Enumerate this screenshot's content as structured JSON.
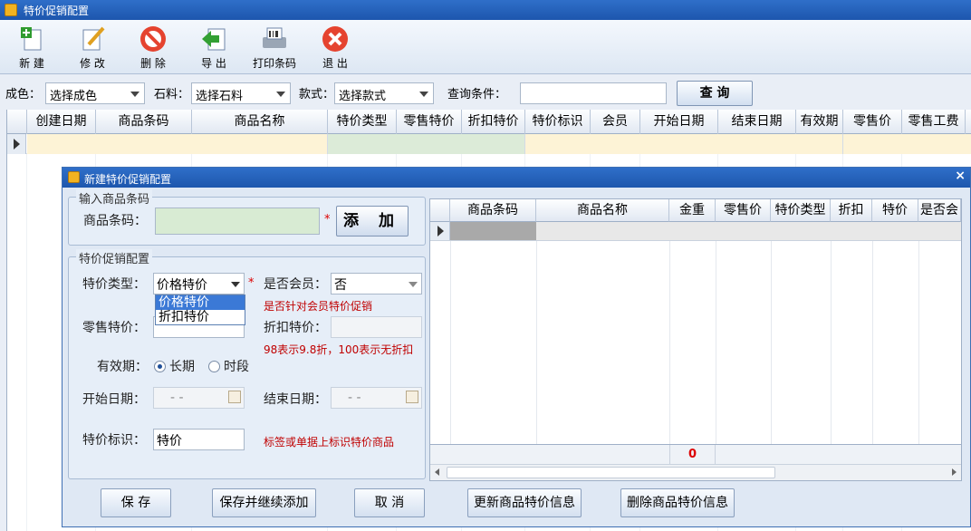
{
  "window": {
    "title": "特价促销配置"
  },
  "toolbar": [
    {
      "label": "新 建",
      "icon": "new-icon"
    },
    {
      "label": "修 改",
      "icon": "edit-icon"
    },
    {
      "label": "删 除",
      "icon": "delete-icon"
    },
    {
      "label": "导 出",
      "icon": "export-icon"
    },
    {
      "label": "打印条码",
      "icon": "print-barcode-icon"
    },
    {
      "label": "退 出",
      "icon": "exit-icon"
    }
  ],
  "filters": {
    "color_label": "成色：",
    "color_value": "选择成色",
    "stone_label": "石料：",
    "stone_value": "选择石料",
    "style_label": "款式：",
    "style_value": "选择款式",
    "query_label": "查询条件：",
    "query_value": "",
    "query_button": "查 询"
  },
  "main_grid": {
    "columns": [
      "创建日期",
      "商品条码",
      "商品名称",
      "特价类型",
      "零售特价",
      "折扣特价",
      "特价标识",
      "会员",
      "开始日期",
      "结束日期",
      "有效期",
      "零售价",
      "零售工费"
    ]
  },
  "dialog": {
    "title": "新建特价促销配置",
    "close": "×",
    "barcode_group": "输入商品条码",
    "barcode_label": "商品条码：",
    "barcode_value": "",
    "required_mark": "*",
    "add_button": "添 加",
    "config_group": "特价促销配置",
    "price_type_label": "特价类型：",
    "price_type_value": "价格特价",
    "price_type_options": [
      "价格特价",
      "折扣特价"
    ],
    "member_label": "是否会员：",
    "member_value": "否",
    "member_hint": "是否针对会员特价促销",
    "retail_price_label": "零售特价：",
    "retail_price_value": "",
    "discount_label": "折扣特价：",
    "discount_value": "",
    "discount_hint": "98表示9.8折，100表示无折扣",
    "validity_label": "有效期：",
    "validity_long": "长期",
    "validity_period": "时段",
    "validity_selected": "长期",
    "start_label": "开始日期：",
    "start_value": "- -",
    "end_label": "结束日期：",
    "end_value": "- -",
    "mark_label": "特价标识：",
    "mark_value": "特价",
    "mark_hint": "标签或单据上标识特价商品",
    "grid_columns": [
      "商品条码",
      "商品名称",
      "金重",
      "零售价",
      "特价类型",
      "折扣",
      "特价",
      "是否会"
    ],
    "grid_sum_weight": "0",
    "buttons": [
      "保 存",
      "保存并继续添加",
      "取 消",
      "更新商品特价信息",
      "删除商品特价信息"
    ]
  }
}
